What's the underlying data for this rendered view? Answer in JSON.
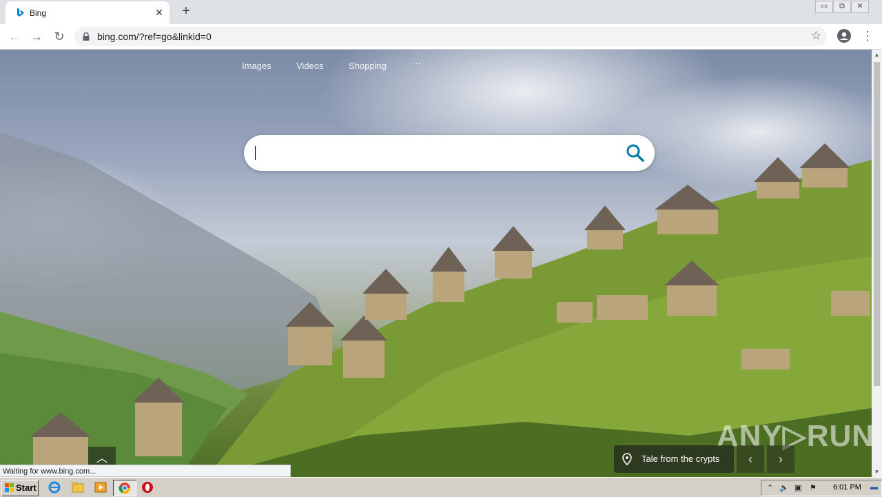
{
  "browser": {
    "tab_title": "Bing",
    "tab_close": "✕",
    "new_tab": "+",
    "url": "bing.com/?ref=go&linkid=0",
    "window_buttons": [
      "▭",
      "⧉",
      "✕"
    ]
  },
  "bing": {
    "nav": [
      "Images",
      "Videos",
      "Shopping",
      "···"
    ],
    "search_placeholder": "",
    "caption": "Tale from the crypts",
    "prev_arrow": "‹",
    "next_arrow": "›",
    "up_arrow": "︿",
    "status_text": "Waiting for www.bing.com...",
    "watermark": "ANY▷RUN"
  },
  "taskbar": {
    "start_label": "Start",
    "clock": "6:01 PM"
  },
  "colors": {
    "bing_blue": "#0078d4",
    "search_icon": "#007daa"
  }
}
